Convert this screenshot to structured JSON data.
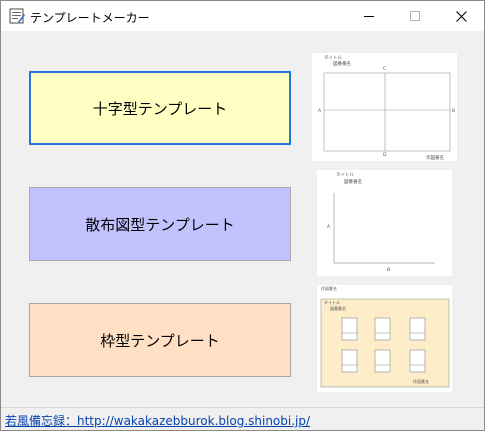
{
  "window": {
    "title": "テンプレートメーカー",
    "controls": {
      "minimize": "minimize",
      "maximize": "maximize",
      "close": "close"
    }
  },
  "buttons": [
    {
      "label": "十字型テンプレート",
      "color": "#ffffc4",
      "border": "#1f78d6"
    },
    {
      "label": "散布図型テンプレート",
      "color": "#c2c2ff",
      "border": "#a8a8a8"
    },
    {
      "label": "枠型テンプレート",
      "color": "#ffe0c4",
      "border": "#a8a8a8"
    }
  ],
  "thumbnails": {
    "cross": {
      "title": "タイトル",
      "subtitle": "図番番名",
      "top": "C",
      "bottom": "D",
      "left": "A",
      "right": "B",
      "footer": "作図番名"
    },
    "scatter": {
      "title": "タイトル",
      "subtitle": "図番番名",
      "y_label": "A",
      "x_label": "B"
    },
    "frame": {
      "header": "作図番名",
      "title": "タイトル",
      "subtitle": "図番番名",
      "footer": "作図番名",
      "frame_color": "#fdedc8"
    }
  },
  "status": {
    "link_text": "若風備忘録：http://wakakazebburok.blog.shinobi.jp/"
  }
}
